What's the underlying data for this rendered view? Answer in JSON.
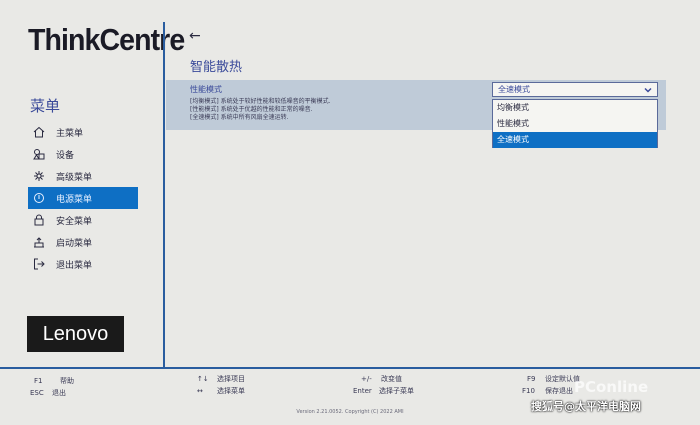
{
  "brand": "ThinkCentre",
  "sidebar": {
    "title": "菜单",
    "items": [
      {
        "label": "主菜单",
        "icon": "home-icon"
      },
      {
        "label": "设备",
        "icon": "devices-icon"
      },
      {
        "label": "高级菜单",
        "icon": "advanced-icon"
      },
      {
        "label": "电源菜单",
        "icon": "power-icon",
        "active": true
      },
      {
        "label": "安全菜单",
        "icon": "lock-icon"
      },
      {
        "label": "启动菜单",
        "icon": "startup-icon"
      },
      {
        "label": "退出菜单",
        "icon": "exit-icon"
      }
    ],
    "logo": "Lenovo"
  },
  "main": {
    "back": "←",
    "title": "智能散热",
    "setting": {
      "label": "性能模式",
      "desc1": "[均衡模式] 系统处于较好性能和较低噪音的平衡模式.",
      "desc2": "[性能模式] 系统处于优越的性能和正常的噪音.",
      "desc3": "[全速模式] 系统中所有风扇全速运转.",
      "value": "全速模式",
      "options": [
        "均衡模式",
        "性能模式",
        "全速模式"
      ],
      "selected_index": 2
    }
  },
  "footer": {
    "f1_key": "F1",
    "f1_label": "帮助",
    "esc_key": "ESC",
    "esc_label": "退出",
    "updown_key": "↑↓",
    "updown_label": "选择项目",
    "leftright_key": "↔",
    "leftright_label": "选择菜单",
    "plusminus_key": "+/-",
    "plusminus_label": "改变值",
    "enter_key": "Enter",
    "enter_label": "选择子菜单",
    "f9_key": "F9",
    "f9_label": "设定默认值",
    "f10_key": "F10",
    "f10_label": "保存退出",
    "version": "Version 2.21.0052. Copyright (C) 2022 AMI"
  },
  "watermark": "搜狐号@太平洋电脑网",
  "watermark_faint": "PConline",
  "colors": {
    "accent": "#0e6fc4",
    "divider": "#2a5d9f",
    "row": "#bfcbd8"
  }
}
